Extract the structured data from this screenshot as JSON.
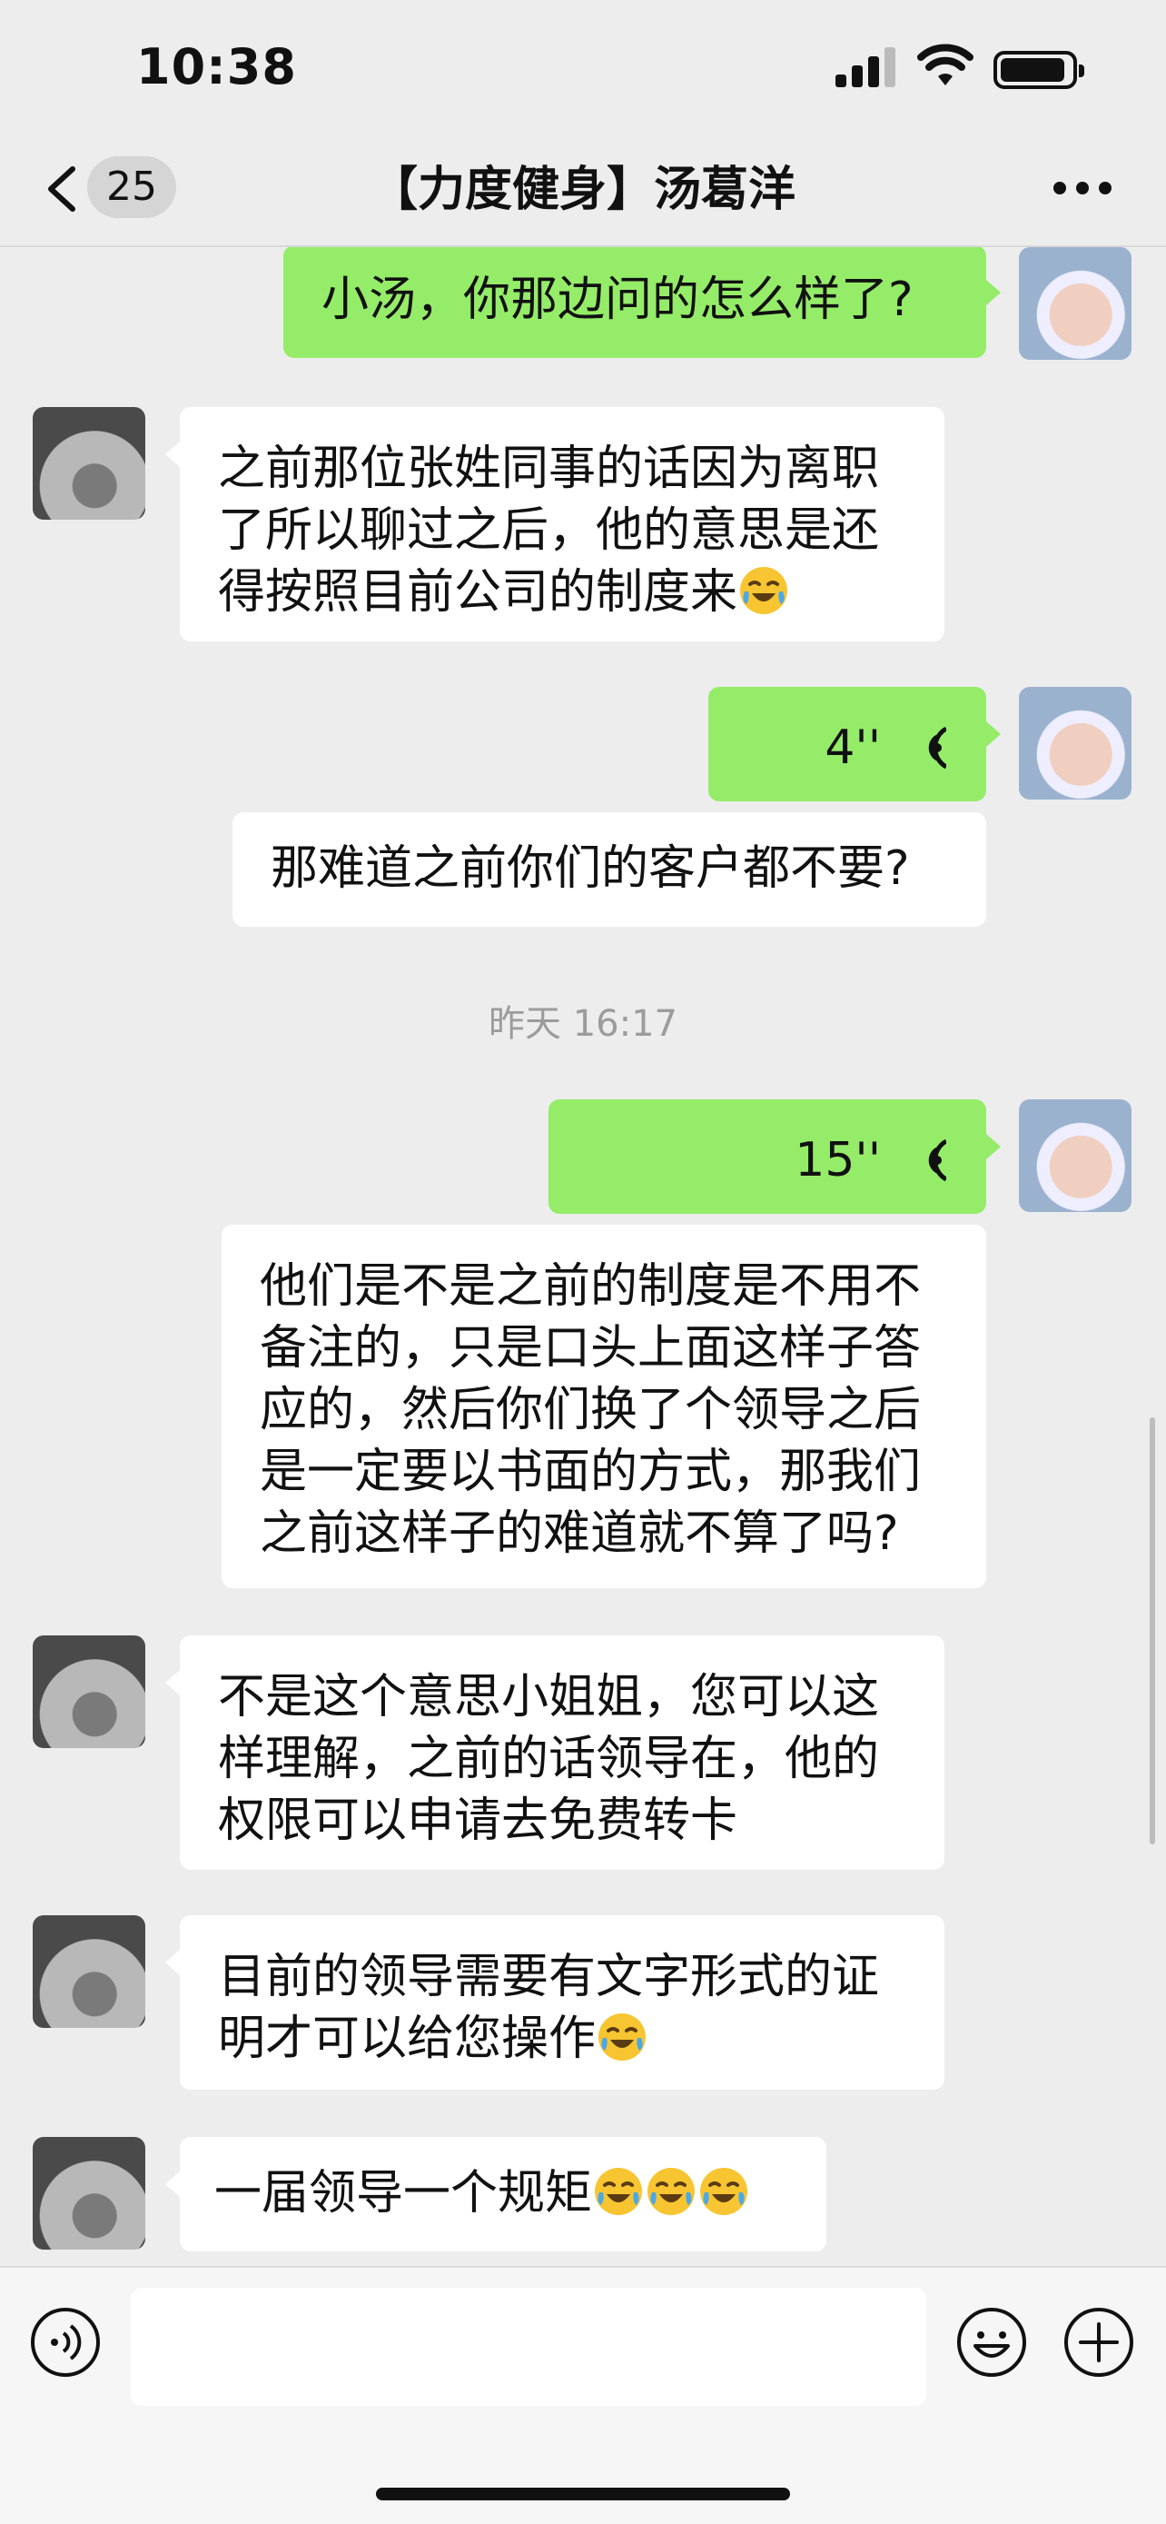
{
  "status_bar": {
    "time": "10:38",
    "battery_level": 0.85
  },
  "nav": {
    "back_icon": "chevron-left-icon",
    "unread_count": "25",
    "title": "【力度健身】汤葛洋",
    "more_icon": "more-dots-icon"
  },
  "messages": [
    {
      "side": "right",
      "type": "text",
      "text": "小汤，你那边问的怎么样了?"
    },
    {
      "side": "left",
      "type": "text",
      "text": "之前那位张姓同事的话因为离职了所以聊过之后，他的意思是还得按照目前公司的制度来",
      "emoji": "laughing-crying-emoji"
    },
    {
      "side": "right",
      "type": "voice",
      "duration": "4''"
    },
    {
      "side": "right",
      "type": "text",
      "text": "那难道之前你们的客户都不要?"
    },
    {
      "side": "right",
      "type": "voice",
      "duration": "15''"
    },
    {
      "side": "right",
      "type": "text",
      "text": "他们是不是之前的制度是不用不备注的，只是口头上面这样子答应的，然后你们换了个领导之后是一定要以书面的方式，那我们之前这样子的难道就不算了吗?"
    },
    {
      "side": "left",
      "type": "text",
      "text": "不是这个意思小姐姐，您可以这样理解，之前的话领导在，他的权限可以申请去免费转卡"
    },
    {
      "side": "left",
      "type": "text",
      "text": "目前的领导需要有文字形式的证明才可以给您操作",
      "emoji": "laughing-crying-emoji"
    },
    {
      "side": "left",
      "type": "text",
      "text": "一届领导一个规矩",
      "emoji_count": 3
    }
  ],
  "timestamp": "昨天 16:17",
  "input_bar": {
    "voice_icon": "voice-input-icon",
    "text_value": "",
    "emoji_icon": "smiley-icon",
    "plus_icon": "add-icon"
  },
  "colors": {
    "self_bubble": "#95ec69",
    "other_bubble": "#ffffff",
    "background": "#ededed"
  }
}
